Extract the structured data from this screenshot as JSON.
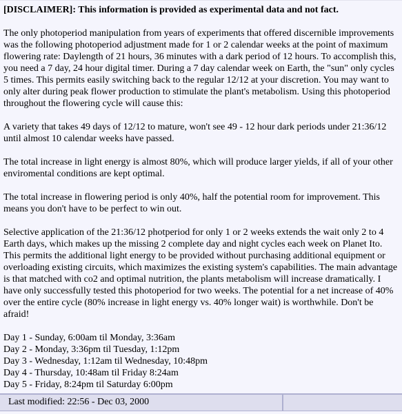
{
  "disclaimer": "[DISCLAIMER]: This information is provided as experimental data and not fact.",
  "paragraphs": [
    "The only photoperiod manipulation from years of experiments that offered discernible improvements was the following photoperiod adjustment made for 1 or 2 calendar weeks at the point of maximum flowering rate: Daylength of 21 hours, 36 minutes with a dark period of 12 hours. To accomplish this, you need a 7 day, 24 hour digital timer. During a 7 day calendar week on Earth, the \"sun\" only cycles 5 times. This permits easily switching back to the regular 12/12 at your discretion. You may want to only alter during peak flower production to stimulate the plant's metabolism. Using this photoperiod throughout the flowering cycle will cause this:",
    "A variety that takes 49 days of 12/12 to mature, won't see 49 - 12 hour dark periods under 21:36/12 until almost 10 calendar weeks have passed.",
    "The total increase in light energy is almost 80%, which will produce larger yields, if all of your other enviromental conditions are kept optimal.",
    "The total increase in flowering period is only 40%, half the potential room for improvement. This means you don't have to be perfect to win out.",
    "Selective application of the 21:36/12 photperiod for only 1 or 2 weeks extends the wait only 2 to 4 Earth days, which makes up the missing 2 complete day and night cycles each week on Planet Ito. This permits the additional light energy to be provided without purchasing additional equipment or overloading existing circuits, which maximizes the existing system's capabilities. The main advantage is that matched with co2 and optimal nutrition, the plants metabolism will increase dramatically. I have only successfully tested this photoperiod for two weeks. The potential for a net increase of 40% over the entire cycle (80% increase in light energy vs. 40% longer wait) is worthwhile. Don't be afraid!"
  ],
  "schedule": [
    "Day 1 - Sunday, 6:00am til Monday, 3:36am",
    "Day 2 - Monday, 3:36pm til Tuesday, 1:12pm",
    "Day 3 - Wednesday, 1:12am til Wednesday, 10:48pm",
    "Day 4 - Thursday, 10:48am til Friday 8:24am",
    "Day 5 - Friday, 8:24pm til Saturday 6:00pm"
  ],
  "footer": {
    "last_modified": "Last modified: 22:56 - Dec 03, 2000",
    "right_cell": ""
  },
  "colors": {
    "page_background": "#f5f5fd",
    "footer_background": "#dedeee",
    "border": "#aeb0d0",
    "text": "#000000"
  }
}
